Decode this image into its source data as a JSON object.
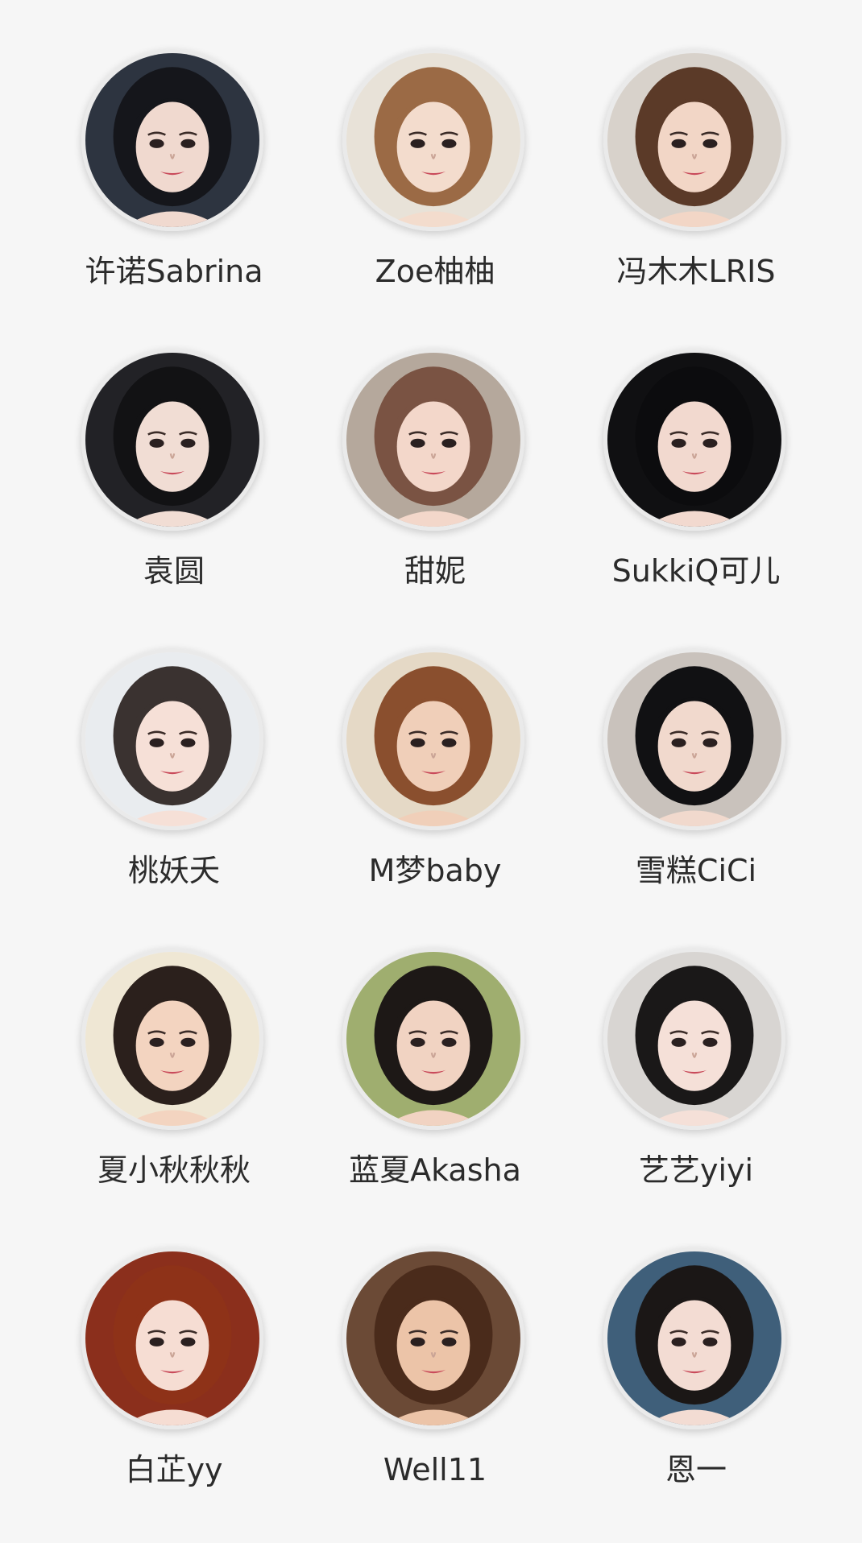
{
  "profiles": [
    {
      "name": "许诺Sabrina",
      "bg": "#2d3440",
      "hair": "#15161b",
      "skin": "#f0d9cf"
    },
    {
      "name": "Zoe柚柚",
      "bg": "#e8e2d8",
      "hair": "#9b6a45",
      "skin": "#f3dccd"
    },
    {
      "name": "冯木木LRIS",
      "bg": "#d8d2cb",
      "hair": "#5b3a28",
      "skin": "#f2d6c6"
    },
    {
      "name": "袁圆",
      "bg": "#222226",
      "hair": "#121214",
      "skin": "#f1ddd4"
    },
    {
      "name": "甜妮",
      "bg": "#b5a89c",
      "hair": "#7a5343",
      "skin": "#f3d7ca"
    },
    {
      "name": "SukkiQ可儿",
      "bg": "#101012",
      "hair": "#0c0c0e",
      "skin": "#f2d9cf"
    },
    {
      "name": "桃妖夭",
      "bg": "#e9ecef",
      "hair": "#3a3230",
      "skin": "#f6e0d7"
    },
    {
      "name": "M梦baby",
      "bg": "#e5d9c6",
      "hair": "#8a4f2e",
      "skin": "#f0cfb9"
    },
    {
      "name": "雪糕CiCi",
      "bg": "#c9c2bc",
      "hair": "#111113",
      "skin": "#f1d9cd"
    },
    {
      "name": "夏小秋秋秋",
      "bg": "#efe7d4",
      "hair": "#2b201c",
      "skin": "#f3d4c0"
    },
    {
      "name": "蓝夏Akasha",
      "bg": "#9fae6f",
      "hair": "#1d1816",
      "skin": "#f1d3c2"
    },
    {
      "name": "艺艺yiyi",
      "bg": "#d8d5d2",
      "hair": "#1a1818",
      "skin": "#f5e0d8"
    },
    {
      "name": "白芷yy",
      "bg": "#8b2f1c",
      "hair": "#8e3218",
      "skin": "#f6ddd3"
    },
    {
      "name": "Well11",
      "bg": "#6b4a36",
      "hair": "#4a2b1b",
      "skin": "#ecc4a8"
    },
    {
      "name": "恩一",
      "bg": "#3f5f7a",
      "hair": "#1b1716",
      "skin": "#f3dcd3"
    }
  ]
}
